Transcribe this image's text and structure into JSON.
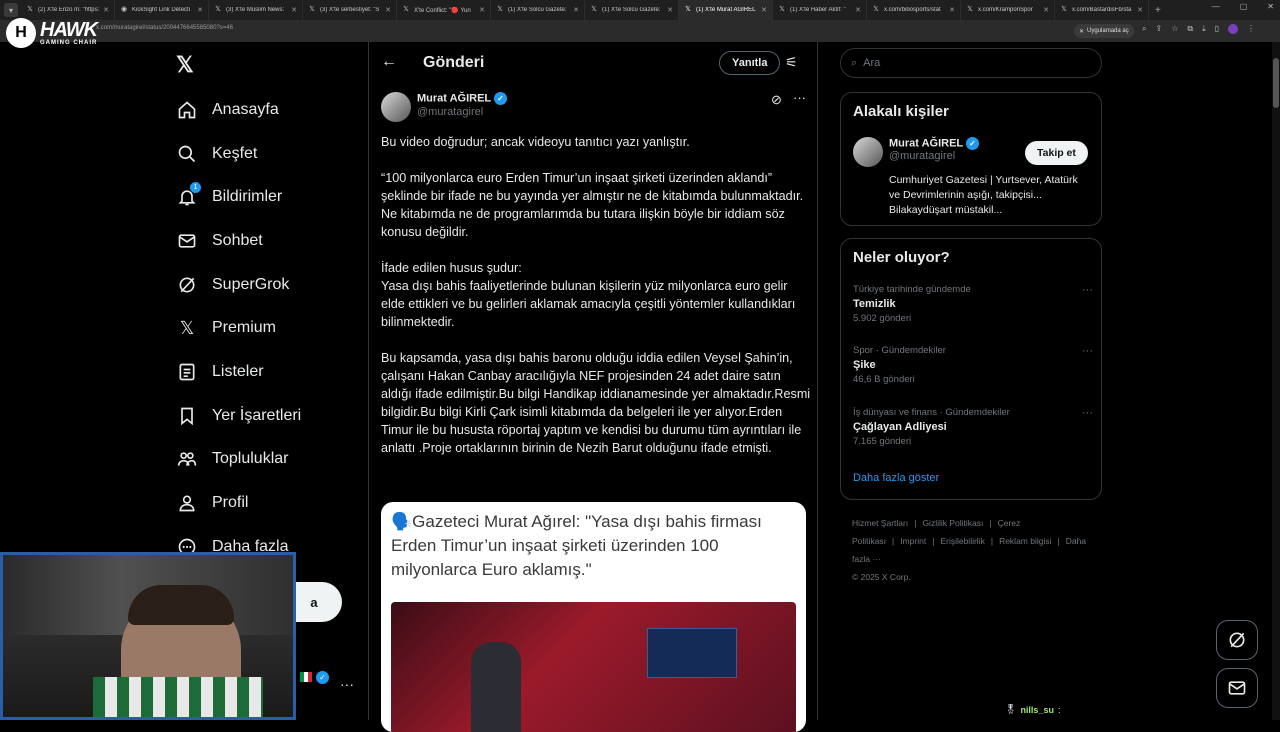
{
  "browser": {
    "tabs": [
      {
        "label": "(2) X'te Enzo m: \"https:",
        "icon": "𝕏"
      },
      {
        "label": "KickSight Link Detecti",
        "icon": "◉"
      },
      {
        "label": "(3) X'te Muslim News:",
        "icon": "𝕏"
      },
      {
        "label": "(3) X'te serbestiyet: \"S",
        "icon": "𝕏"
      },
      {
        "label": "X'te Conflict: \"🔴 Yun",
        "icon": "𝕏"
      },
      {
        "label": "(1) X'te Solcu Gazete:",
        "icon": "𝕏"
      },
      {
        "label": "(1) X'te Solcu Gazete:",
        "icon": "𝕏"
      },
      {
        "label": "(1) X'te Murat AĞIREL",
        "icon": "𝕏",
        "active": true
      },
      {
        "label": "(1) X'te Haber Aktif: \"",
        "icon": "𝕏"
      },
      {
        "label": "x.com/bibosports/stat",
        "icon": "𝕏"
      },
      {
        "label": "x.com/KramponSpor",
        "icon": "𝕏"
      },
      {
        "label": "x.com/BastardisFb/sta",
        "icon": "𝕏"
      }
    ],
    "url": "x.com/muratagirel/status/2004476645585080?s=46",
    "app_button": "Uygulamada aç"
  },
  "overlay": {
    "logo_title": "HAWK",
    "logo_subtitle": "GAMING CHAIR"
  },
  "nav": {
    "items": [
      {
        "label": "Anasayfa",
        "icon": "home-icon"
      },
      {
        "label": "Keşfet",
        "icon": "search-icon"
      },
      {
        "label": "Bildirimler",
        "icon": "bell-icon",
        "badge": "1"
      },
      {
        "label": "Sohbet",
        "icon": "mail-icon"
      },
      {
        "label": "SuperGrok",
        "icon": "grok-icon"
      },
      {
        "label": "Premium",
        "icon": "x-icon"
      },
      {
        "label": "Listeler",
        "icon": "list-icon"
      },
      {
        "label": "Yer İşaretleri",
        "icon": "bookmark-icon"
      },
      {
        "label": "Topluluklar",
        "icon": "people-icon"
      },
      {
        "label": "Profil",
        "icon": "person-icon"
      },
      {
        "label": "Daha fazla",
        "icon": "more-circle-icon"
      }
    ],
    "post_button_partial": "a"
  },
  "header": {
    "title": "Gönderi",
    "reply_button": "Yanıtla"
  },
  "post": {
    "author_name": "Murat AĞIREL",
    "author_handle": "@muratagirel",
    "text": "Bu video doğrudur; ancak videoyu tanıtıcı yazı yanlıştır.\n\n“100 milyonlarca euro Erden Timur’un inşaat şirketi üzerinden aklandı” şeklinde bir ifade ne bu yayında yer almıştır ne de kitabımda bulunmaktadır.\nNe kitabımda ne de programlarımda bu tutara ilişkin böyle bir iddiam söz konusu değildir.\n\nİfade edilen husus şudur:\nYasa dışı bahis faaliyetlerinde bulunan kişilerin yüz milyonlarca euro gelir elde ettikleri ve bu gelirleri aklamak amacıyla çeşitli yöntemler kullandıkları bilinmektedir.\n\nBu kapsamda, yasa dışı bahis baronu olduğu iddia edilen Veysel Şahin’in, çalışanı Hakan Canbay aracılığıyla NEF projesinden 24 adet daire satın aldığı ifade edilmiştir.Bu bilgi Handikap iddianamesinde yer almaktadır.Resmi bilgidir.Bu bilgi Kirli Çark isimli kitabımda da belgeleri ile yer alıyor.Erden Timur ile bu hususta röportaj yaptım ve kendisi bu durumu tüm ayrıntıları ile anlattı .Proje ortaklarının birinin de Nezih Barut olduğunu ifade etmişti.",
    "quoted_text": "🗣️Gazeteci Murat Ağırel: \"Yasa dışı bahis firması Erden Timur’un inşaat şirketi üzerinden 100 milyonlarca Euro aklamış.\""
  },
  "right": {
    "search_placeholder": "Ara",
    "related_title": "Alakalı kişiler",
    "related": {
      "name": "Murat AĞIREL",
      "handle": "@muratagirel",
      "bio": "Cumhuriyet Gazetesi | Yurtsever, Atatürk ve Devrimlerinin aşığı, takipçisi... Bilakaydüşart müstakil...",
      "follow_button": "Takip et"
    },
    "trends_title": "Neler oluyor?",
    "trends": [
      {
        "category": "Türkiye tarihinde gündemde",
        "name": "Temizlik",
        "count": "5.902 gönderi"
      },
      {
        "category": "Spor · Gündemdekiler",
        "name": "Şike",
        "count": "46,6 B gönderi"
      },
      {
        "category": "İş dünyası ve finans · Gündemdekiler",
        "name": "Çağlayan Adliyesi",
        "count": "7.165 gönderi"
      }
    ],
    "show_more": "Daha fazla göster",
    "footer_links": [
      "Hizmet Şartları",
      "|",
      "Gizlilik Politikası",
      "|",
      "Çerez Politikası",
      "|",
      "Imprint",
      "|",
      "Erişilebilirlik",
      "|",
      "Reklam bilgisi",
      "|",
      "Daha fazla ···"
    ],
    "copyright": "© 2025 X Corp."
  },
  "stream_chat": {
    "username": "nills_su",
    "suffix": ":"
  }
}
